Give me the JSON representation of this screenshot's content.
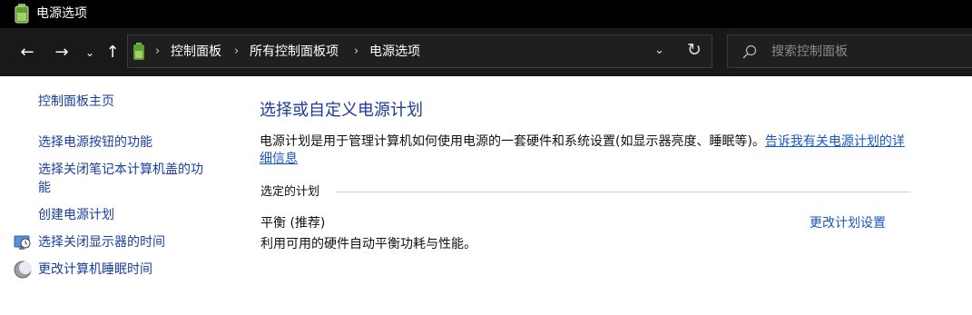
{
  "window": {
    "title": "电源选项"
  },
  "address_bar": {
    "crumbs": [
      "控制面板",
      "所有控制面板项",
      "电源选项"
    ]
  },
  "search": {
    "placeholder": "搜索控制面板"
  },
  "left_nav": {
    "home": "控制面板主页",
    "links": [
      "选择电源按钮的功能",
      "选择关闭笔记本计算机盖的功",
      "能",
      "创建电源计划",
      "选择关闭显示器的时间",
      "更改计算机睡眠时间"
    ]
  },
  "main": {
    "heading": "选择或自定义电源计划",
    "description": "电源计划是用于管理计算机如何使用电源的一套硬件和系统设置(如显示器亮度、睡眠等)。",
    "description_link": "告诉我有关电源计划的详细信息",
    "section_label": "选定的计划",
    "plan": {
      "name": "平衡 (推荐)",
      "description": "利用可用的硬件自动平衡功耗与性能。",
      "change_link": "更改计划设置"
    }
  },
  "icons": [
    "power-options-icon",
    "back-arrow-icon",
    "forward-arrow-icon",
    "recent-dropdown-icon",
    "up-arrow-icon",
    "breadcrumb-separator-icon",
    "chevron-down-icon",
    "refresh-icon",
    "search-icon",
    "monitor-clock-icon",
    "moon-icon"
  ]
}
